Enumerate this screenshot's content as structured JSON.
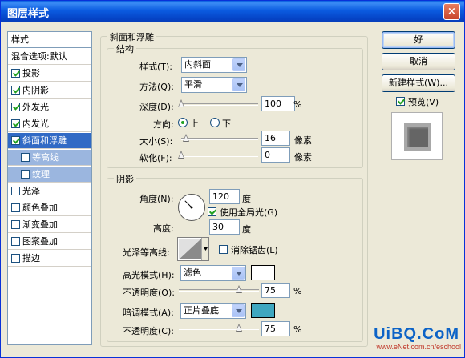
{
  "window": {
    "title": "图层样式",
    "close_glyph": "×"
  },
  "stylelist": {
    "header": "样式",
    "items": [
      {
        "label": "混合选项:默认",
        "checkbox": false,
        "checked": false,
        "state": "normal"
      },
      {
        "label": "投影",
        "checkbox": true,
        "checked": true,
        "state": "normal"
      },
      {
        "label": "内阴影",
        "checkbox": true,
        "checked": true,
        "state": "normal"
      },
      {
        "label": "外发光",
        "checkbox": true,
        "checked": true,
        "state": "normal"
      },
      {
        "label": "内发光",
        "checkbox": true,
        "checked": true,
        "state": "normal"
      },
      {
        "label": "斜面和浮雕",
        "checkbox": true,
        "checked": true,
        "state": "selected"
      },
      {
        "label": "等高线",
        "checkbox": true,
        "checked": false,
        "state": "sub"
      },
      {
        "label": "纹理",
        "checkbox": true,
        "checked": false,
        "state": "sub"
      },
      {
        "label": "光泽",
        "checkbox": true,
        "checked": false,
        "state": "normal"
      },
      {
        "label": "颜色叠加",
        "checkbox": true,
        "checked": false,
        "state": "normal"
      },
      {
        "label": "渐变叠加",
        "checkbox": true,
        "checked": false,
        "state": "normal"
      },
      {
        "label": "图案叠加",
        "checkbox": true,
        "checked": false,
        "state": "normal"
      },
      {
        "label": "描边",
        "checkbox": true,
        "checked": false,
        "state": "normal"
      }
    ]
  },
  "bevel": {
    "title": "斜面和浮雕",
    "structure": {
      "title": "结构",
      "style_label": "样式(T):",
      "style_value": "内斜面",
      "technique_label": "方法(Q):",
      "technique_value": "平滑",
      "depth_label": "深度(D):",
      "depth_value": "100",
      "depth_unit": "%",
      "depth_slider_fraction": 0.0,
      "direction_label": "方向:",
      "direction_up": "上",
      "direction_down": "下",
      "direction_selected": "上",
      "size_label": "大小(S):",
      "size_value": "16",
      "size_unit": "像素",
      "size_slider_fraction": 0.06,
      "soften_label": "软化(F):",
      "soften_value": "0",
      "soften_unit": "像素",
      "soften_slider_fraction": 0.0
    },
    "shading": {
      "title": "阴影",
      "angle_label": "角度(N):",
      "angle_value": "120",
      "angle_unit": "度",
      "global_light_label": "使用全局光(G)",
      "global_light_checked": true,
      "altitude_label": "高度:",
      "altitude_value": "30",
      "altitude_unit": "度",
      "gloss_contour_label": "光泽等高线:",
      "antialias_label": "消除锯齿(L)",
      "antialias_checked": false,
      "highlight_mode_label": "高光模式(H):",
      "highlight_mode_value": "滤色",
      "highlight_color": "#ffffff",
      "highlight_opacity_label": "不透明度(O):",
      "highlight_opacity_value": "75",
      "highlight_opacity_unit": "%",
      "highlight_opacity_fraction": 0.75,
      "shadow_mode_label": "暗调模式(A):",
      "shadow_mode_value": "正片叠底",
      "shadow_color": "#3fa7c0",
      "shadow_opacity_label": "不透明度(C):",
      "shadow_opacity_value": "75",
      "shadow_opacity_unit": "%",
      "shadow_opacity_fraction": 0.75
    }
  },
  "buttons": {
    "ok": "好",
    "cancel": "取消",
    "new_style": "新建样式(W)...",
    "preview_label": "预览(V)",
    "preview_checked": true
  },
  "watermark": {
    "line1": "UiBQ.CoM",
    "line2": "www.eNet.com.cn/eschool"
  },
  "colors": {
    "selected": "#316ac5",
    "titlebar": "#0a5fe0"
  }
}
